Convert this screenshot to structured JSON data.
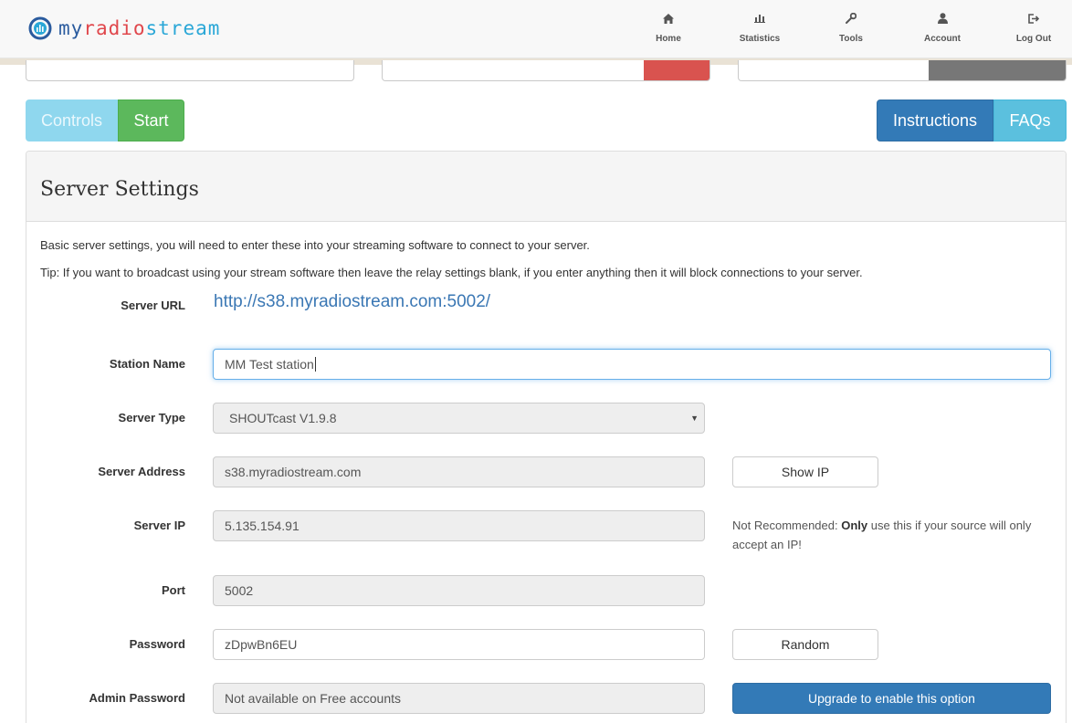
{
  "brand": {
    "text_my": "my",
    "text_radio": "radio",
    "text_stream": "stream",
    "colors": {
      "my": "#2a5b9e",
      "radio": "#e0474c",
      "stream": "#2aa7d7"
    }
  },
  "nav": {
    "items": [
      {
        "label": "Home",
        "icon": "home-icon"
      },
      {
        "label": "Statistics",
        "icon": "statistics-icon"
      },
      {
        "label": "Tools",
        "icon": "wrench-icon"
      },
      {
        "label": "Account",
        "icon": "user-icon"
      },
      {
        "label": "Log Out",
        "icon": "logout-icon"
      }
    ]
  },
  "toolbar": {
    "controls_label": "Controls",
    "start_label": "Start",
    "instructions_label": "Instructions",
    "faqs_label": "FAQs"
  },
  "panel": {
    "title": "Server Settings",
    "intro": "Basic server settings, you will need to enter these into your streaming software to connect to your server.",
    "tip": "Tip: If you want to broadcast using your stream software then leave the relay settings blank, if you enter anything then it will block connections to your server."
  },
  "form": {
    "server_url": {
      "label": "Server URL",
      "value": "http://s38.myradiostream.com:5002/"
    },
    "station_name": {
      "label": "Station Name",
      "value": "MM Test station"
    },
    "server_type": {
      "label": "Server Type",
      "value": "SHOUTcast V1.9.8"
    },
    "server_address": {
      "label": "Server Address",
      "value": "s38.myradiostream.com",
      "button": "Show IP"
    },
    "server_ip": {
      "label": "Server IP",
      "value": "5.135.154.91",
      "note_prefix": "Not Recommended: ",
      "note_bold": "Only",
      "note_suffix": " use this if your source will only accept an IP!"
    },
    "port": {
      "label": "Port",
      "value": "5002"
    },
    "password": {
      "label": "Password",
      "value": "zDpwBn6EU",
      "button": "Random"
    },
    "admin_password": {
      "label": "Admin Password",
      "value": "Not available on Free accounts",
      "button": "Upgrade to enable this option"
    }
  },
  "colors": {
    "success": "#5cb85c",
    "primary": "#337ab7",
    "info": "#5bc0de",
    "danger": "#d9534f",
    "muted": "#777777"
  }
}
